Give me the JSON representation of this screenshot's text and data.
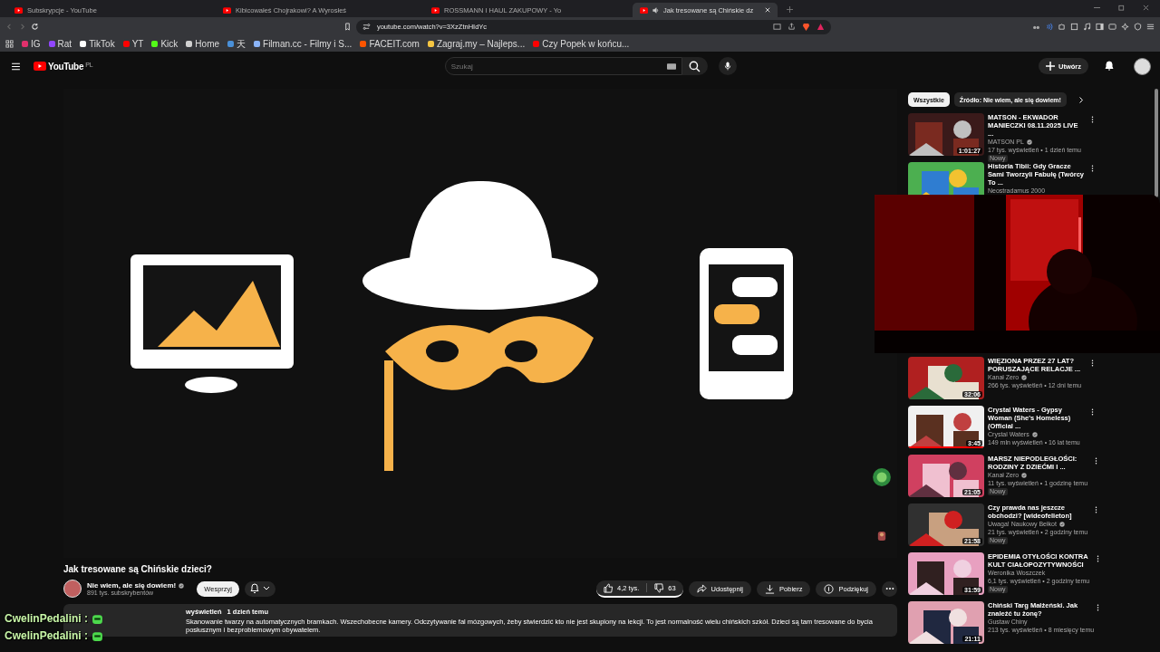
{
  "browser": {
    "tabs": [
      {
        "title": "Subskrypcje - YouTube",
        "selected": false,
        "audio": false
      },
      {
        "title": "Kibicowałeś Chojrakowi? A Wyrosłeś",
        "selected": false,
        "audio": false
      },
      {
        "title": "ROSSMANN I HAUL ZAKUPOWY - Yo",
        "selected": false,
        "audio": false
      },
      {
        "title": "Jak tresowane są Chińskie dz",
        "selected": true,
        "audio": true
      }
    ],
    "url": "youtube.com/watch?v=3XzZtnHIdYc",
    "bookmarks": [
      {
        "label": "IG",
        "color": "#e1306c"
      },
      {
        "label": "Rat",
        "color": "#9146ff"
      },
      {
        "label": "TikTok",
        "color": "#ffffff"
      },
      {
        "label": "YT",
        "color": "#ff0000"
      },
      {
        "label": "Kick",
        "color": "#53fc18"
      },
      {
        "label": "Home",
        "color": "#d0d0d0"
      },
      {
        "label": "天",
        "color": "#4a90d9"
      },
      {
        "label": "Filman.cc - Filmy i S...",
        "color": "#8ab4f8"
      },
      {
        "label": "FACEIT.com",
        "color": "#ff5500"
      },
      {
        "label": "Zagraj.my – Najleps...",
        "color": "#f5c542"
      },
      {
        "label": "Czy Popek w końcu...",
        "color": "#ff0000"
      }
    ]
  },
  "header": {
    "logo": "YouTube",
    "region": "PL",
    "search": {
      "placeholder": "Szukaj"
    },
    "create": "Utwórz"
  },
  "video": {
    "kind": "picture",
    "title": "Jak tresowane są Chińskie dzieci?",
    "channel": {
      "name": "Nie wiem, ale się dowiem!",
      "verified": true,
      "subscribers": "891 tys. subskrybentów"
    },
    "support": "Wesprzyj",
    "likes": "4,2 tys.",
    "dislikes": "63",
    "share": "Udostępnij",
    "download": "Pobierz",
    "thanks": "Podziękuj",
    "description": {
      "views": "wyświetleń",
      "date": "1 dzień temu",
      "text": "Skanowanie twarzy na automatycznych bramkach. Wszechobecne kamery. Odczytywanie fal mózgowych, żeby stwierdzić kto nie jest skupiony na lekcji. To jest normalność wielu chińskich szkół. Dzieci są tam tresowane do bycia posłusznym i bezproblemowym obywatelem."
    }
  },
  "filters": [
    {
      "label": "Wszystkie",
      "selected": true
    },
    {
      "label": "Źródło: Nie wiem, ale się dowiem!",
      "selected": false
    }
  ],
  "recommendations": [
    {
      "title": "MATSON - EKWADOR MANIECZKI 08.11.2025 LIVE ...",
      "channel": "MATSON PL",
      "verified": true,
      "meta": "17 tys. wyświetleń • 1 dzień temu",
      "badge": "Nowy",
      "duration": "1:01:27"
    },
    {
      "title": "Historia Tibii: Gdy Gracze Sami Tworzyli Fabułę (Twórcy To ...",
      "channel": "Neostradamus 2000"
    },
    {
      "title": "WIĘZIONA PRZEZ 27 LAT? PORUSZAJĄCE RELACJE ...",
      "channel": "Kanał Zero",
      "verified": true,
      "meta": "266 tys. wyświetleń • 12 dni temu",
      "duration": "32:06"
    },
    {
      "title": "Crystal Waters - Gypsy Woman (She's Homeless) (Official ...",
      "channel": "Crystal Waters",
      "verified": true,
      "meta": "149 mln wyświetleń • 16 lat temu",
      "duration": "3:45",
      "level": 1
    },
    {
      "title": "MARSZ NIEPODLEGŁOŚCI: RODZINY Z DZIEĆMI I ...",
      "channel": "Kanał Zero",
      "verified": true,
      "meta": "11 tys. wyświetleń • 1 godzinę temu",
      "badge": "Nowy",
      "duration": "21:05"
    },
    {
      "title": "Czy prawda nas jeszcze obchodzi? [wideofelieton]",
      "channel": "Uwaga! Naukowy Bełkot",
      "verified": true,
      "meta": "21 tys. wyświetleń • 2 godziny temu",
      "badge": "Nowy",
      "duration": "21:58"
    },
    {
      "title": "EPIDEMIA OTYŁOŚCI KONTRA KULT CIAŁOPOZYTYWNOŚCI",
      "channel": "Weronika Woszczek",
      "meta": "6,1 tys. wyświetleń • 2 godziny temu",
      "badge": "Nowy",
      "duration": "31:59"
    },
    {
      "title": "Chiński Targ Małżeński. Jak znaleźć tu żonę?",
      "channel": "Gustaw Chiny",
      "meta": "213 tys. wyświetleń • 8 miesięcy temu",
      "duration": "21:11"
    }
  ],
  "overlay": {
    "chat": [
      "CwelinPedalini :",
      "CwelinPedalini :"
    ]
  }
}
